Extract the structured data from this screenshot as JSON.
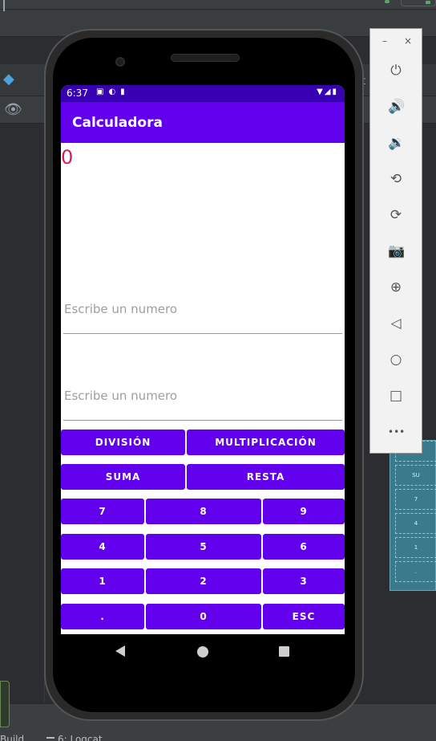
{
  "ide": {
    "bottom_tabs": {
      "build": "Build",
      "logcat": "6: Logcat"
    },
    "partial_text": "t",
    "preview_labels": [
      "DIVI",
      "SU",
      "7",
      "4",
      "1",
      "."
    ]
  },
  "device": {
    "status_bar": {
      "time": "6:37"
    },
    "app_bar": {
      "title": "Calculadora"
    },
    "display": {
      "result": "0"
    },
    "inputs": [
      {
        "placeholder": "Escribe un numero",
        "value": ""
      },
      {
        "placeholder": "Escribe un numero",
        "value": ""
      }
    ],
    "buttons": {
      "division": "DIVISIÓN",
      "multiplicacion": "MULTIPLICACIÓN",
      "suma": "SUMA",
      "resta": "RESTA",
      "seven": "7",
      "eight": "8",
      "nine": "9",
      "four": "4",
      "five": "5",
      "six": "6",
      "one": "1",
      "two": "2",
      "three": "3",
      "dot": ".",
      "zero": "0",
      "esc": "ESC"
    }
  },
  "emulator_panel": {
    "minimize": "–",
    "close": "×",
    "tools": [
      {
        "name": "power-icon",
        "glyph": "⏻"
      },
      {
        "name": "volume-up-icon",
        "glyph": "🔊"
      },
      {
        "name": "volume-down-icon",
        "glyph": "🔉"
      },
      {
        "name": "rotate-left-icon",
        "glyph": "⟲"
      },
      {
        "name": "rotate-right-icon",
        "glyph": "⟳"
      },
      {
        "name": "camera-icon",
        "glyph": "📷"
      },
      {
        "name": "zoom-icon",
        "glyph": "⊕"
      },
      {
        "name": "back-icon",
        "glyph": "◁"
      },
      {
        "name": "home-icon",
        "glyph": "○"
      },
      {
        "name": "overview-icon",
        "glyph": "□"
      },
      {
        "name": "more-icon",
        "glyph": "•••"
      }
    ]
  },
  "colors": {
    "primary": "#6200ee",
    "primary_dark": "#3700b3",
    "accent_result": "#d81b60"
  }
}
